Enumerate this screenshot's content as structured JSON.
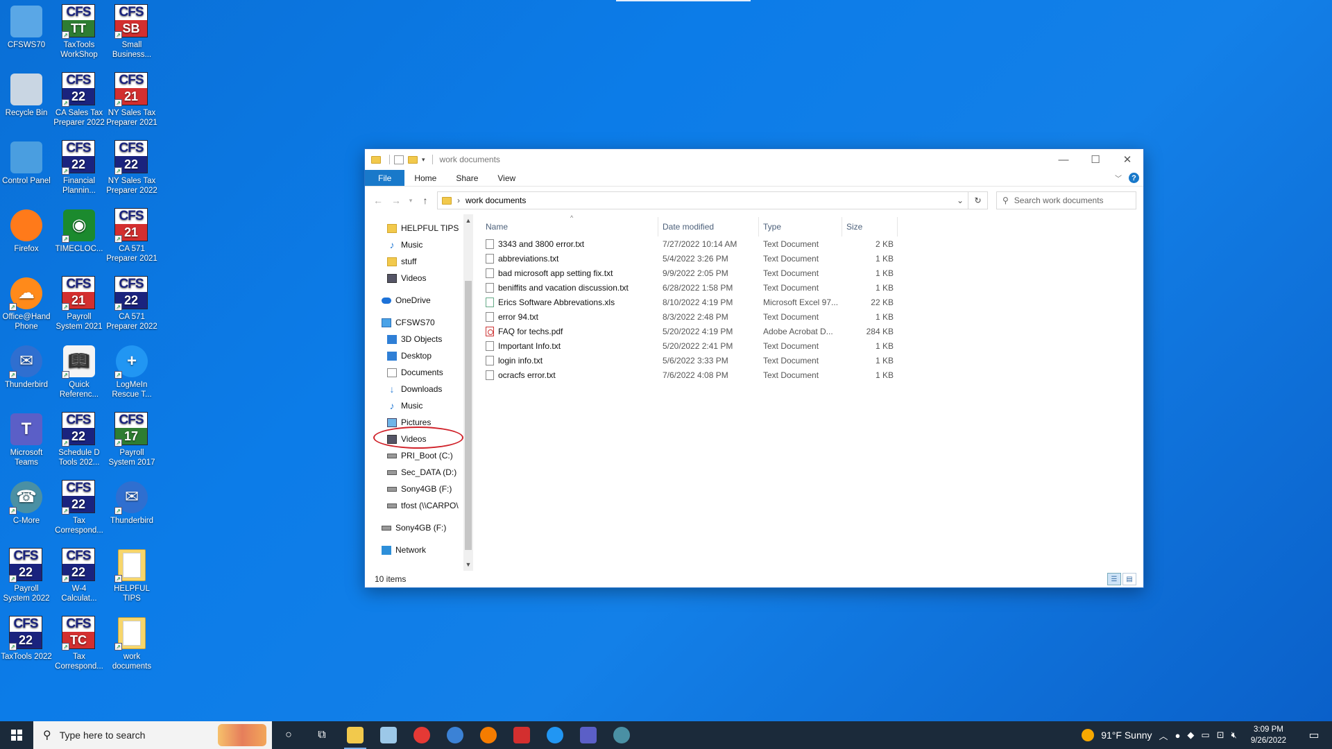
{
  "desktop": {
    "icons": [
      {
        "label": "CFSWS70"
      },
      {
        "label": "TaxTools\nWorkShop",
        "cfs_top": "CFS",
        "cfs_bottom": "TT"
      },
      {
        "label": "Small\nBusiness...",
        "cfs_top": "CFS",
        "cfs_bottom": "SB"
      },
      {
        "label": "Recycle Bin"
      },
      {
        "label": "CA Sales Tax\nPreparer 2022",
        "cfs_top": "CFS",
        "cfs_bottom": "22"
      },
      {
        "label": "NY Sales Tax\nPreparer 2021",
        "cfs_top": "CFS",
        "cfs_bottom": "21"
      },
      {
        "label": "Control Panel"
      },
      {
        "label": "Financial\nPlannin...",
        "cfs_top": "CFS",
        "cfs_bottom": "22"
      },
      {
        "label": "NY Sales Tax\nPreparer 2022",
        "cfs_top": "CFS",
        "cfs_bottom": "22"
      },
      {
        "label": "Firefox"
      },
      {
        "label": "TIMECLOC..."
      },
      {
        "label": "CA 571\nPreparer 2021",
        "cfs_top": "CFS",
        "cfs_bottom": "21"
      },
      {
        "label": "Office@Hand\nPhone"
      },
      {
        "label": "Payroll\nSystem 2021",
        "cfs_top": "CFS",
        "cfs_bottom": "21"
      },
      {
        "label": "CA 571\nPreparer 2022",
        "cfs_top": "CFS",
        "cfs_bottom": "22"
      },
      {
        "label": "Thunderbird"
      },
      {
        "label": "Quick\nReferenc..."
      },
      {
        "label": "LogMeIn\nRescue T..."
      },
      {
        "label": "Microsoft\nTeams"
      },
      {
        "label": "Schedule D\nTools 202...",
        "cfs_top": "CFS",
        "cfs_bottom": "22"
      },
      {
        "label": "Payroll\nSystem 2017",
        "cfs_top": "CFS",
        "cfs_bottom": "17"
      },
      {
        "label": "C-More"
      },
      {
        "label": "Tax\nCorrespond...",
        "cfs_top": "CFS",
        "cfs_bottom": "22"
      },
      {
        "label": "Thunderbird"
      },
      {
        "label": "Payroll\nSystem 2022",
        "cfs_top": "CFS",
        "cfs_bottom": "22"
      },
      {
        "label": "W-4\nCalculat...",
        "cfs_top": "CFS",
        "cfs_bottom": "22"
      },
      {
        "label": "HELPFUL\nTIPS"
      },
      {
        "label": "TaxTools 2022",
        "cfs_top": "CFS",
        "cfs_bottom": "22"
      },
      {
        "label": "Tax\nCorrespond...",
        "cfs_top": "CFS",
        "cfs_bottom": "TC"
      },
      {
        "label": "work\ndocuments"
      }
    ]
  },
  "explorer": {
    "title": "work documents",
    "ribbon_tabs": {
      "file": "File",
      "home": "Home",
      "share": "Share",
      "view": "View"
    },
    "help": "?",
    "address": {
      "path_item": "work documents",
      "separator": "›"
    },
    "search": {
      "placeholder": "Search work documents"
    },
    "nav": {
      "quick": [
        "HELPFUL TIPS",
        "Music",
        "stuff",
        "Videos"
      ],
      "onedrive": "OneDrive",
      "pc": "CFSWS70",
      "pc_items": [
        "3D Objects",
        "Desktop",
        "Documents",
        "Downloads",
        "Music",
        "Pictures",
        "Videos",
        "PRI_Boot (C:)",
        "Sec_DATA (D:)",
        "Sony4GB (F:)",
        "tfost (\\\\CARPO\\"
      ],
      "usb": "Sony4GB (F:)",
      "network": "Network"
    },
    "columns": {
      "name": "Name",
      "date": "Date modified",
      "type": "Type",
      "size": "Size"
    },
    "files": [
      {
        "name": "3343 and 3800 error.txt",
        "date": "7/27/2022 10:14 AM",
        "type": "Text Document",
        "size": "2 KB",
        "kind": "txt"
      },
      {
        "name": "abbreviations.txt",
        "date": "5/4/2022 3:26 PM",
        "type": "Text Document",
        "size": "1 KB",
        "kind": "txt"
      },
      {
        "name": "bad microsoft app setting fix.txt",
        "date": "9/9/2022 2:05 PM",
        "type": "Text Document",
        "size": "1 KB",
        "kind": "txt"
      },
      {
        "name": "beniffits and vacation discussion.txt",
        "date": "6/28/2022 1:58 PM",
        "type": "Text Document",
        "size": "1 KB",
        "kind": "txt"
      },
      {
        "name": "Erics Software Abbrevations.xls",
        "date": "8/10/2022 4:19 PM",
        "type": "Microsoft Excel 97...",
        "size": "22 KB",
        "kind": "xls"
      },
      {
        "name": "error 94.txt",
        "date": "8/3/2022 2:48 PM",
        "type": "Text Document",
        "size": "1 KB",
        "kind": "txt"
      },
      {
        "name": "FAQ for techs.pdf",
        "date": "5/20/2022 4:19 PM",
        "type": "Adobe Acrobat D...",
        "size": "284 KB",
        "kind": "pdf"
      },
      {
        "name": "Important Info.txt",
        "date": "5/20/2022 2:41 PM",
        "type": "Text Document",
        "size": "1 KB",
        "kind": "txt"
      },
      {
        "name": "login info.txt",
        "date": "5/6/2022 3:33 PM",
        "type": "Text Document",
        "size": "1 KB",
        "kind": "txt"
      },
      {
        "name": "ocracfs  error.txt",
        "date": "7/6/2022 4:08 PM",
        "type": "Text Document",
        "size": "1 KB",
        "kind": "txt"
      }
    ],
    "status": "10 items"
  },
  "taskbar": {
    "search_placeholder": "Type here to search",
    "weather": "91°F  Sunny",
    "time": "3:09 PM",
    "date": "9/26/2022"
  },
  "colors": {
    "accent": "#1979ca",
    "highlight_ring": "#d0222a",
    "taskbar": "#1b2a3a"
  }
}
